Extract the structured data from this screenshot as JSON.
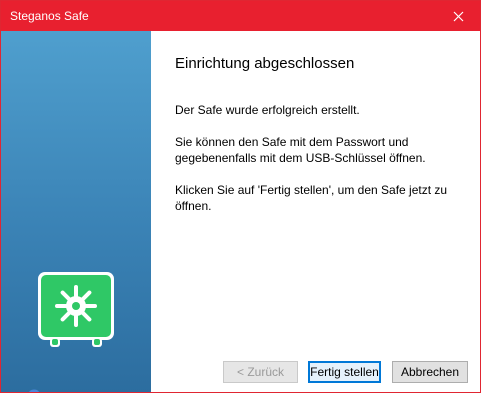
{
  "window": {
    "title": "Steganos Safe",
    "close_glyph": "✕"
  },
  "sidebar": {
    "safe_icon": "safe-icon",
    "help_glyph": "?"
  },
  "content": {
    "heading": "Einrichtung abgeschlossen",
    "paragraphs": [
      "Der Safe wurde erfolgreich erstellt.",
      "Sie können den Safe mit dem Passwort und gegebenenfalls mit dem USB-Schlüssel öffnen.",
      "Klicken Sie auf 'Fertig stellen', um den Safe jetzt zu öffnen."
    ]
  },
  "buttons": {
    "back": "< Zurück",
    "finish": "Fertig stellen",
    "cancel": "Abbrechen"
  },
  "colors": {
    "titlebar": "#e8202f",
    "sidebar": "#3a82b5",
    "safe_green": "#2fc866",
    "default_button_border": "#0078d7"
  }
}
